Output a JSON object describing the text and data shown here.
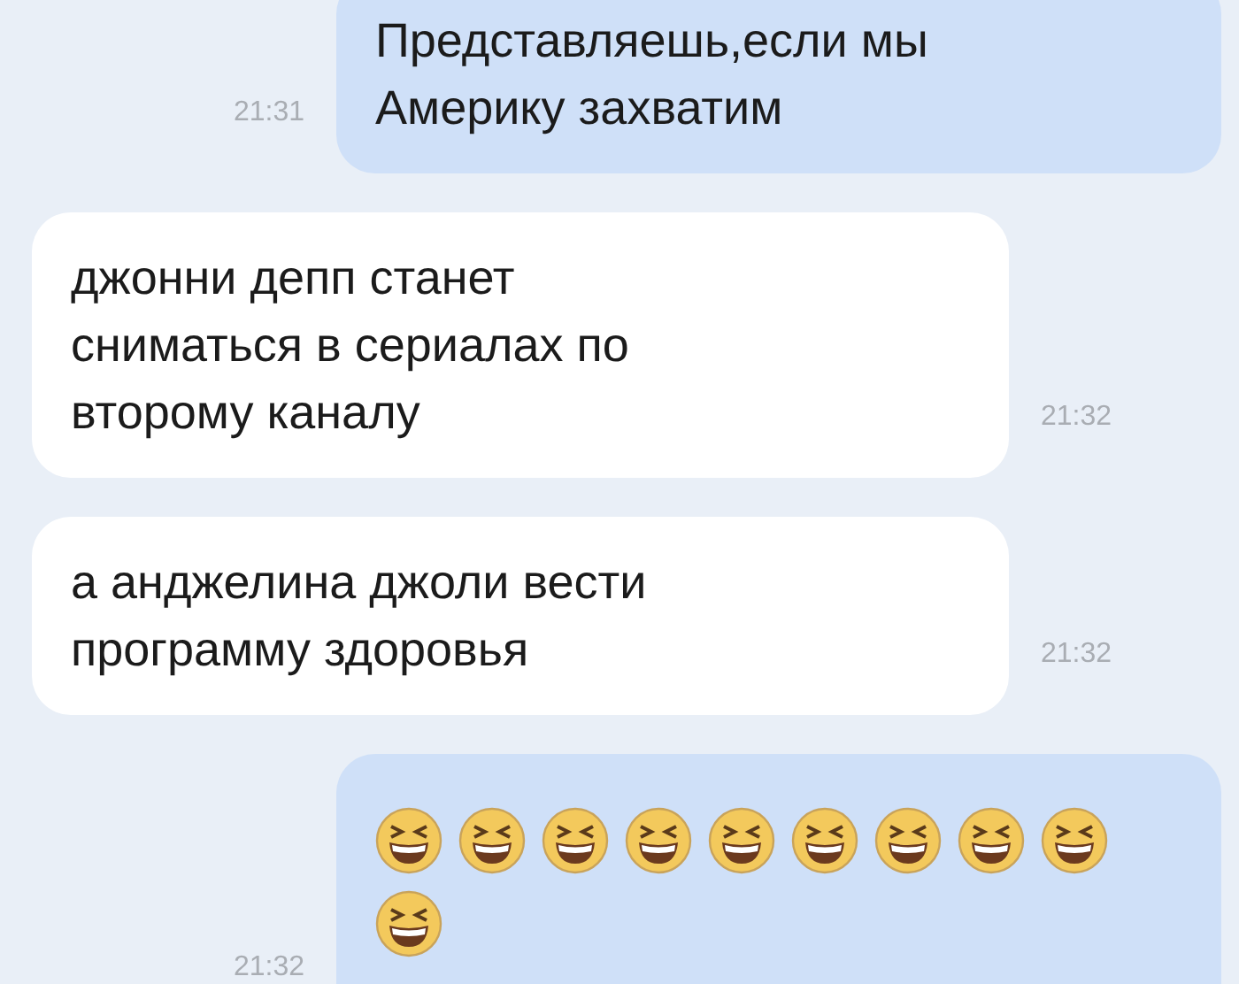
{
  "messages": [
    {
      "kind": "text",
      "outgoing": true,
      "text": "Представляешь,если мы\nАмерику захватим",
      "time": "21:31"
    },
    {
      "kind": "text",
      "outgoing": false,
      "text": "джонни депп станет\nсниматься в сериалах по\nвторому каналу",
      "time": "21:32"
    },
    {
      "kind": "text",
      "outgoing": false,
      "text": "а анджелина джоли вести\nпрограмму здоровья",
      "time": "21:32"
    },
    {
      "kind": "emoji",
      "outgoing": true,
      "emojis": [
        {
          "kind": "laughing"
        },
        {
          "kind": "laughing"
        },
        {
          "kind": "laughing"
        },
        {
          "kind": "laughing"
        },
        {
          "kind": "laughing"
        },
        {
          "kind": "laughing"
        },
        {
          "kind": "laughing"
        },
        {
          "kind": "laughing"
        },
        {
          "kind": "laughing"
        },
        {
          "kind": "laughing"
        }
      ],
      "time": "21:32"
    }
  ]
}
